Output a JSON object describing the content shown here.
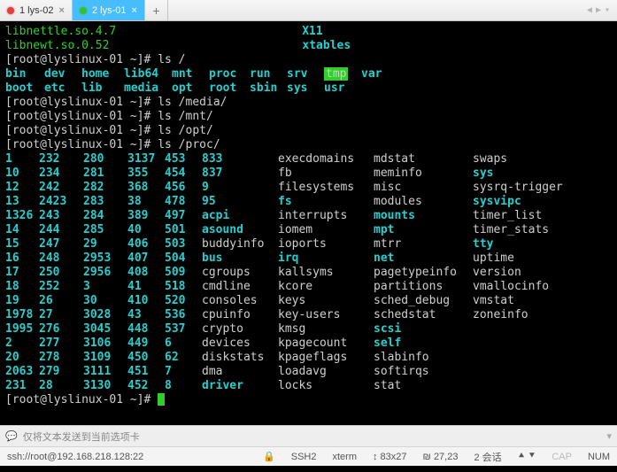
{
  "tabs": [
    {
      "indicator": "red",
      "label": "1 lys-02",
      "active": false
    },
    {
      "indicator": "green",
      "label": "2 lys-01",
      "active": true
    }
  ],
  "top_lines": [
    {
      "left": "libnettle.so.4.7",
      "right": "X11"
    },
    {
      "left": "libnewt.so.0.52",
      "right": "xtables"
    }
  ],
  "prompt": "[root@lyslinux-01 ~]#",
  "cmds": {
    "ls_root": "ls /",
    "ls_media": "ls /media/",
    "ls_mnt": "ls /mnt/",
    "ls_opt": "ls /opt/",
    "ls_proc": "ls /proc/"
  },
  "root_listing": [
    [
      "bin",
      "dev",
      "home",
      "lib64",
      "mnt",
      "proc",
      "run",
      "srv",
      "tmp",
      "var"
    ],
    [
      "boot",
      "etc",
      "lib",
      "media",
      "opt",
      "root",
      "sbin",
      "sys",
      "usr",
      ""
    ]
  ],
  "proc": [
    [
      "1",
      "232",
      "280",
      "3137",
      "453",
      "833",
      "execdomains",
      "mdstat",
      "swaps"
    ],
    [
      "10",
      "234",
      "281",
      "355",
      "454",
      "837",
      "fb",
      "meminfo",
      "sys"
    ],
    [
      "12",
      "242",
      "282",
      "368",
      "456",
      "9",
      "filesystems",
      "misc",
      "sysrq-trigger"
    ],
    [
      "13",
      "2423",
      "283",
      "38",
      "478",
      "95",
      "fs",
      "modules",
      "sysvipc"
    ],
    [
      "1326",
      "243",
      "284",
      "389",
      "497",
      "acpi",
      "interrupts",
      "mounts",
      "timer_list"
    ],
    [
      "14",
      "244",
      "285",
      "40",
      "501",
      "asound",
      "iomem",
      "mpt",
      "timer_stats"
    ],
    [
      "15",
      "247",
      "29",
      "406",
      "503",
      "buddyinfo",
      "ioports",
      "mtrr",
      "tty"
    ],
    [
      "16",
      "248",
      "2953",
      "407",
      "504",
      "bus",
      "irq",
      "net",
      "uptime"
    ],
    [
      "17",
      "250",
      "2956",
      "408",
      "509",
      "cgroups",
      "kallsyms",
      "pagetypeinfo",
      "version"
    ],
    [
      "18",
      "252",
      "3",
      "41",
      "518",
      "cmdline",
      "kcore",
      "partitions",
      "vmallocinfo"
    ],
    [
      "19",
      "26",
      "30",
      "410",
      "520",
      "consoles",
      "keys",
      "sched_debug",
      "vmstat"
    ],
    [
      "1978",
      "27",
      "3028",
      "43",
      "536",
      "cpuinfo",
      "key-users",
      "schedstat",
      "zoneinfo"
    ],
    [
      "1995",
      "276",
      "3045",
      "448",
      "537",
      "crypto",
      "kmsg",
      "scsi",
      ""
    ],
    [
      "2",
      "277",
      "3106",
      "449",
      "6",
      "devices",
      "kpagecount",
      "self",
      ""
    ],
    [
      "20",
      "278",
      "3109",
      "450",
      "62",
      "diskstats",
      "kpageflags",
      "slabinfo",
      ""
    ],
    [
      "2063",
      "279",
      "3111",
      "451",
      "7",
      "dma",
      "loadavg",
      "softirqs",
      ""
    ],
    [
      "231",
      "28",
      "3130",
      "452",
      "8",
      "driver",
      "locks",
      "stat",
      ""
    ]
  ],
  "proc_special_cyan": {
    "col5": [
      "acpi",
      "asound",
      "bus",
      "driver"
    ],
    "col6": [
      "fs",
      "irq"
    ],
    "col7": [
      "mounts",
      "mpt",
      "net",
      "scsi",
      "self"
    ],
    "col8": [
      "sys",
      "sysvipc",
      "tty"
    ]
  },
  "inputbar": {
    "label": "仅将文本发送到当前选项卡"
  },
  "status": {
    "ssh": "ssh://root@192.168.218.128:22",
    "proto": "SSH2",
    "term": "xterm",
    "size": "83x27",
    "pos": "27,23",
    "sessions": "2 会话",
    "cap": "CAP",
    "num": "NUM"
  }
}
